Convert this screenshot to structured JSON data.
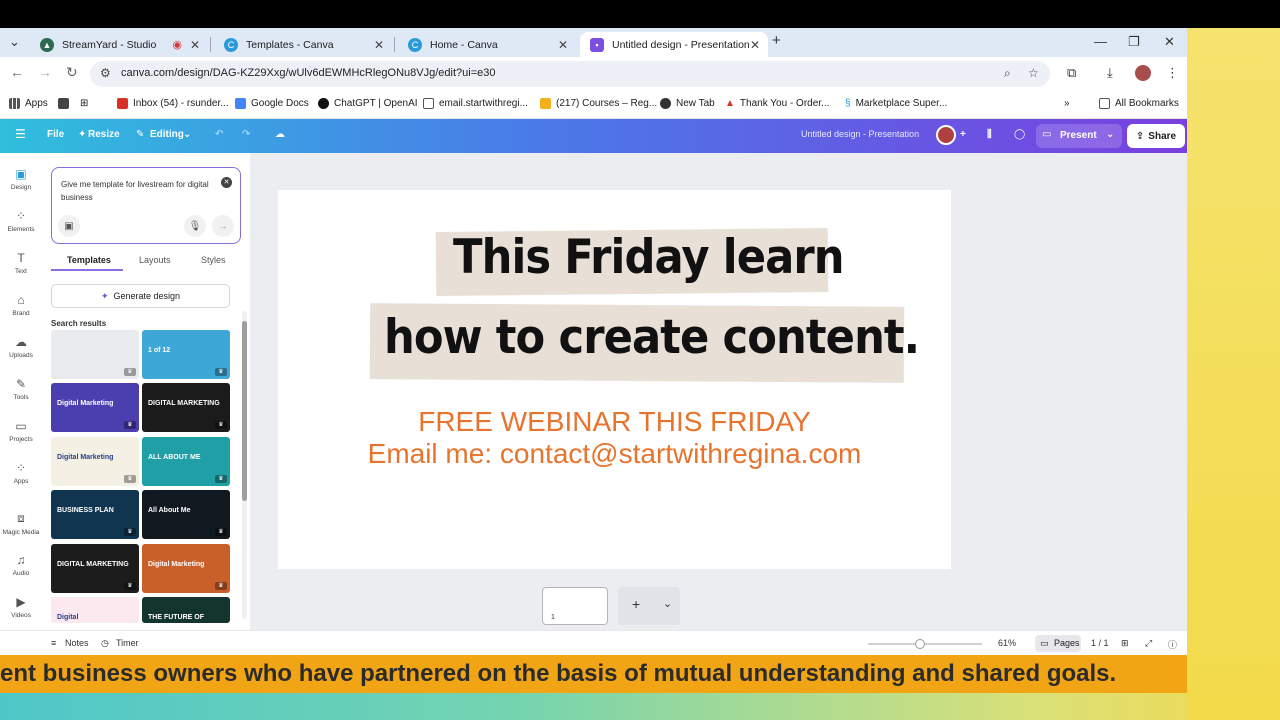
{
  "tabs": [
    {
      "title": "StreamYard - Studio"
    },
    {
      "title": "Templates - Canva"
    },
    {
      "title": "Home - Canva"
    },
    {
      "title": "Untitled design - Presentation"
    }
  ],
  "address_bar": {
    "url": "canva.com/design/DAG-KZ29Xxg/wUlv6dEWMHcRlegONu8VJg/edit?ui=e30"
  },
  "bookmarks": [
    {
      "label": "Apps"
    },
    {
      "label": "Inbox (54) - rsunder..."
    },
    {
      "label": "Google Docs"
    },
    {
      "label": "ChatGPT | OpenAI"
    },
    {
      "label": "email.startwithregi..."
    },
    {
      "label": "(217) Courses – Reg..."
    },
    {
      "label": "New Tab"
    },
    {
      "label": "Thank You - Order..."
    },
    {
      "label": "Marketplace Super..."
    },
    {
      "label": "All Bookmarks"
    }
  ],
  "canva_header": {
    "file": "File",
    "resize": "Resize",
    "editing": "Editing",
    "doc_title": "Untitled design - Presentation",
    "present": "Present",
    "share": "Share"
  },
  "rail": [
    {
      "label": "Design"
    },
    {
      "label": "Elements"
    },
    {
      "label": "Text"
    },
    {
      "label": "Brand"
    },
    {
      "label": "Uploads"
    },
    {
      "label": "Tools"
    },
    {
      "label": "Projects"
    },
    {
      "label": "Apps"
    },
    {
      "label": "Magic Media"
    },
    {
      "label": "Audio"
    },
    {
      "label": "Videos"
    }
  ],
  "panel": {
    "prompt_text": "Give me template for livestream for digital business",
    "tabs": [
      {
        "label": "Templates"
      },
      {
        "label": "Layouts"
      },
      {
        "label": "Styles"
      }
    ],
    "generate": "Generate design",
    "search_results": "Search results",
    "thumbs": [
      {
        "text": "",
        "color": "#e9ebee"
      },
      {
        "text": "1 of 12",
        "color": "#3da8d8"
      },
      {
        "text": "Digital Marketing",
        "color": "#4b3fb0"
      },
      {
        "text": "DIGITAL MARKETING",
        "color": "#1b1b1b"
      },
      {
        "text": "Digital Marketing",
        "color": "#f4f1e4"
      },
      {
        "text": "ALL ABOUT ME",
        "color": "#1f9fa6"
      },
      {
        "text": "BUSINESS PLAN",
        "color": "#0f3550"
      },
      {
        "text": "All About Me",
        "color": "#101820"
      },
      {
        "text": "DIGITAL MARKETING",
        "color": "#1c1c1c"
      },
      {
        "text": "Digital Marketing",
        "color": "#c9602a"
      },
      {
        "text": "Digital",
        "color": "#fbe9ef"
      },
      {
        "text": "THE FUTURE OF DIGITAL",
        "color": "#13352e"
      }
    ]
  },
  "slide": {
    "line1": "This Friday learn",
    "line2": "how to create content.",
    "webinar": "FREE WEBINAR THIS FRIDAY",
    "email": "Email  me: contact@startwithregina.com",
    "text_color": "#e8732d"
  },
  "page_thumb": {
    "number": "1"
  },
  "bottom_bar": {
    "notes": "Notes",
    "timer": "Timer",
    "zoom": "61%",
    "pages": "Pages",
    "page_count": "1 / 1"
  },
  "ticker": {
    "text": "ent business owners who have partnered on the basis of mutual understanding and shared goals."
  }
}
